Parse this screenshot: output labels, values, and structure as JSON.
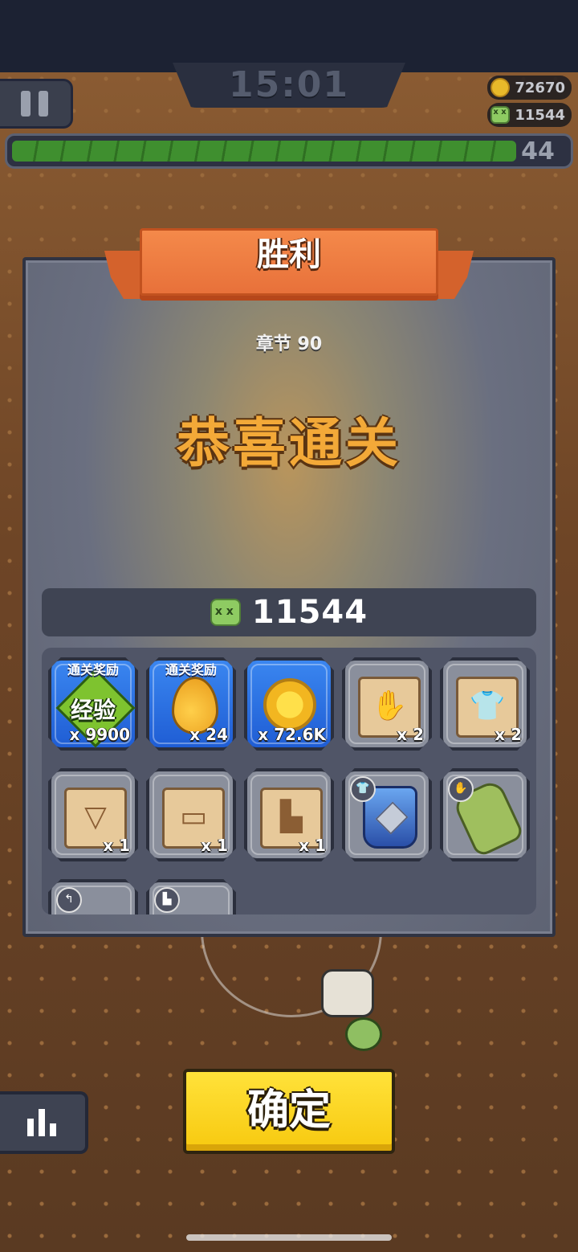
{
  "hud": {
    "timer": "15:01",
    "coins": "72670",
    "kills": "11544",
    "xp_progress": 0.91,
    "level": "44"
  },
  "dialog": {
    "title": "胜利",
    "chapter": "章节 90",
    "headline": "恭喜通关",
    "kill_count": "11544"
  },
  "rewards": [
    {
      "tag": "通关奖励",
      "label": "经验",
      "qty": "x 9900",
      "icon": "exp-gem-icon",
      "style": "blue"
    },
    {
      "tag": "通关奖励",
      "label": "",
      "qty": "x 24",
      "icon": "gold-drop-icon",
      "style": "blue"
    },
    {
      "tag": "",
      "label": "",
      "qty": "x 72.6K",
      "icon": "coin-icon",
      "style": "blue"
    },
    {
      "tag": "",
      "label": "",
      "qty": "x 2",
      "icon": "glove-scroll-icon",
      "style": "gray"
    },
    {
      "tag": "",
      "label": "",
      "qty": "x 2",
      "icon": "armor-scroll-icon",
      "style": "gray"
    },
    {
      "tag": "",
      "label": "",
      "qty": "x 1",
      "icon": "necklace-scroll-icon",
      "style": "gray"
    },
    {
      "tag": "",
      "label": "",
      "qty": "x 1",
      "icon": "belt-scroll-icon",
      "style": "gray"
    },
    {
      "tag": "",
      "label": "",
      "qty": "x 1",
      "icon": "boots-scroll-icon",
      "style": "gray"
    },
    {
      "tag": "",
      "label": "",
      "qty": "",
      "icon": "blue-armor-icon",
      "style": "gray"
    },
    {
      "tag": "",
      "label": "",
      "qty": "",
      "icon": "camo-glove-icon",
      "style": "gray"
    }
  ],
  "confirm_label": "确定",
  "colors": {
    "accent_orange": "#e8713a",
    "confirm_yellow": "#f7c90f",
    "reward_blue": "#2a6fe0",
    "xp_green": "#3f8f2f"
  }
}
